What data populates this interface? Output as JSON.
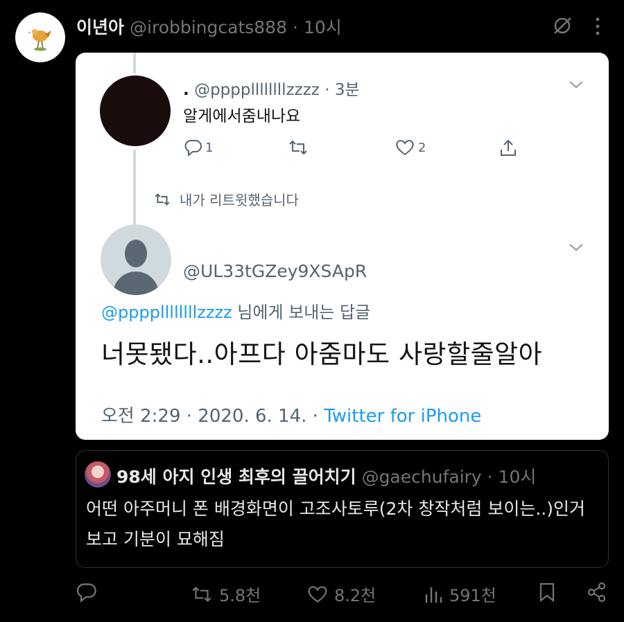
{
  "tweet": {
    "author_name": "이년아",
    "author_handle": "@irobbingcats888",
    "separator": "·",
    "time": "10시"
  },
  "screenshot": {
    "tweet1": {
      "name": ".",
      "handle": "@ppppllllllllzzzz",
      "separator": "·",
      "time": "3분",
      "text": "알게에서줌내나요",
      "reply_count": "1",
      "like_count": "2"
    },
    "retweet_note": "내가 리트윗했습니다",
    "tweet2": {
      "handle": "@UL33tGZey9XSApR",
      "reply_to_handle": "@ppppllllllllzzzz",
      "reply_to_suffix": " 님에게 보내는 답글",
      "text": "너못됐다..아프다 아줌마도 사랑할줄알아",
      "meta_time": "오전 2:29 · 2020. 6. 14. · ",
      "meta_source": "Twitter for iPhone"
    }
  },
  "quote": {
    "name": "98세 아지 인생 최후의 끌어치기",
    "handle": "@gaechufairy",
    "separator": "·",
    "time": "10시",
    "text": "어떤 아주머니 폰 배경화면이 고조사토루(2차 창작처럼 보이는..)인거 보고 기분이 묘해짐"
  },
  "actions": {
    "retweets": "5.8천",
    "likes": "8.2천",
    "views": "591천"
  },
  "colors": {
    "link": "#1d9bf0",
    "muted": "#71767b",
    "text": "#e7e9ea",
    "background": "#000000"
  }
}
